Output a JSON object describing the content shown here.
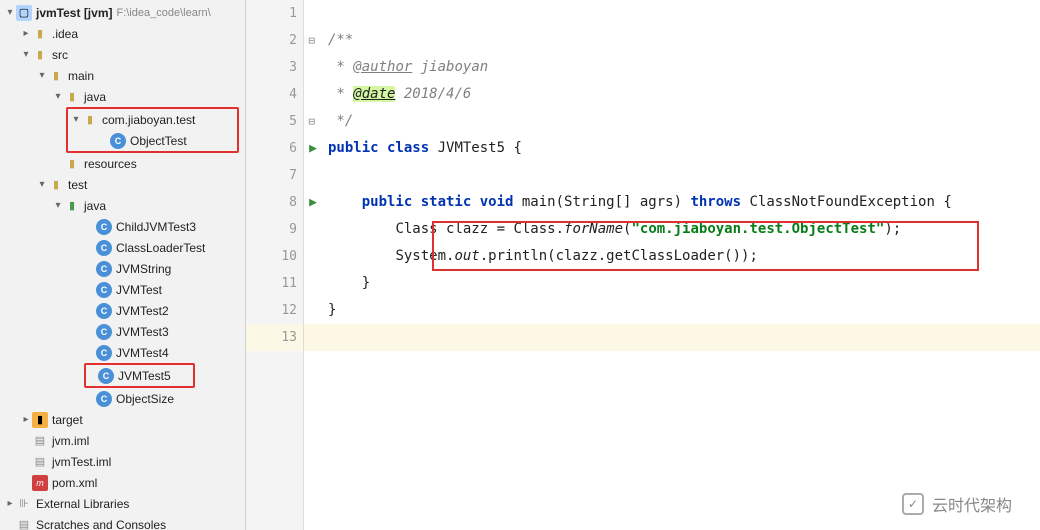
{
  "project": {
    "name": "jvmTest",
    "module": "[jvm]",
    "path": "F:\\idea_code\\learn\\"
  },
  "tree": {
    "idea": ".idea",
    "src": "src",
    "main": "main",
    "java1": "java",
    "pkg": "com.jiaboyan.test",
    "objtest": "ObjectTest",
    "resources": "resources",
    "test": "test",
    "java2": "java",
    "files": [
      "ChildJVMTest3",
      "ClassLoaderTest",
      "JVMString",
      "JVMTest",
      "JVMTest2",
      "JVMTest3",
      "JVMTest4",
      "JVMTest5",
      "ObjectSize"
    ],
    "target": "target",
    "jvmiml": "jvm.iml",
    "jvmtestiml": "jvmTest.iml",
    "pom": "pom.xml",
    "extlib": "External Libraries",
    "scratch": "Scratches and Consoles"
  },
  "code": {
    "author_tag": "@author",
    "author_val": " jiaboyan",
    "date_tag": "@date",
    "date_val": " 2018/4/6",
    "cls": "JVMTest5",
    "method_sig_1": "public static void",
    "method_name": " main",
    "method_args": "(String[] agrs) ",
    "throws": "throws",
    "exc": " ClassNotFoundException {",
    "l1a": "Class clazz = Class.",
    "l1b": "forName",
    "l1c": "(",
    "l1d": "\"com.jiaboyan.test.ObjectTest\"",
    "l1e": ");",
    "l2a": "System.",
    "l2b": "out",
    "l2c": ".println(clazz.getClassLoader());"
  },
  "watermark": "云时代架构"
}
